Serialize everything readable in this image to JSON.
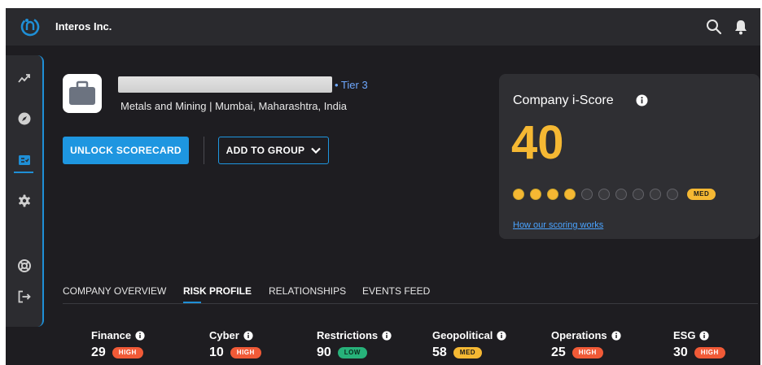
{
  "header": {
    "app_title": "Interos Inc.",
    "search_icon": "search-icon",
    "notification_icon": "bell-icon"
  },
  "sidebar": {
    "items": [
      {
        "icon": "trend-icon"
      },
      {
        "icon": "compass-icon"
      },
      {
        "icon": "scorecard-icon",
        "active": true
      },
      {
        "icon": "gear-icon"
      },
      {
        "icon": "lifebuoy-icon"
      },
      {
        "icon": "logout-icon"
      }
    ]
  },
  "company": {
    "tier": "• Tier 3",
    "industry_location": "Metals and Mining | Mumbai, Maharashtra, India",
    "logo_icon": "briefcase-icon"
  },
  "actions": {
    "unlock_label": "UNLOCK SCORECARD",
    "add_group_label": "ADD TO GROUP"
  },
  "score": {
    "title": "Company i-Score",
    "value": "40",
    "level": "MED",
    "dots_filled": 4,
    "dots_total": 10,
    "link_text": "How our scoring works"
  },
  "tabs": [
    {
      "label": "COMPANY OVERVIEW",
      "active": false
    },
    {
      "label": "RISK PROFILE",
      "active": true
    },
    {
      "label": "RELATIONSHIPS",
      "active": false
    },
    {
      "label": "EVENTS FEED",
      "active": false
    }
  ],
  "risks": [
    {
      "label": "Finance",
      "value": "29",
      "level": "HIGH"
    },
    {
      "label": "Cyber",
      "value": "10",
      "level": "HIGH"
    },
    {
      "label": "Restrictions",
      "value": "90",
      "level": "LOW"
    },
    {
      "label": "Geopolitical",
      "value": "58",
      "level": "MED"
    },
    {
      "label": "Operations",
      "value": "25",
      "level": "HIGH"
    },
    {
      "label": "ESG",
      "value": "30",
      "level": "HIGH"
    }
  ],
  "colors": {
    "accent_blue": "#1e96e0",
    "score_yellow": "#f5b833",
    "high_red": "#f15a37",
    "low_green": "#27b27a",
    "background": "#1e1d21"
  }
}
